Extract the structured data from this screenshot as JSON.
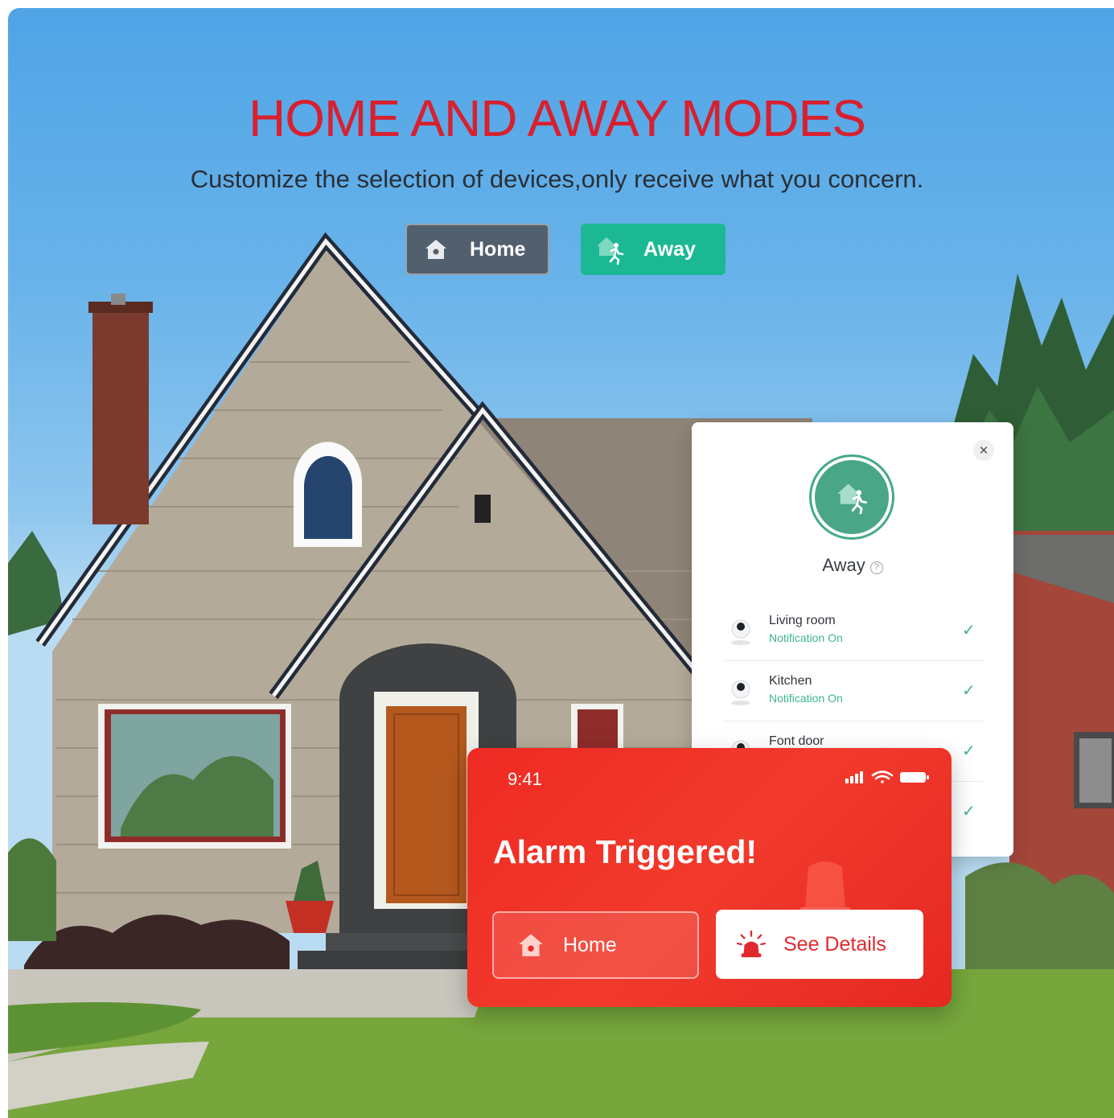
{
  "headline": "HOME AND AWAY MODES",
  "subline": "Customize the selection of devices,only receive what you concern.",
  "mode_buttons": {
    "home_label": "Home",
    "away_label": "Away"
  },
  "panel": {
    "mode_title": "Away",
    "help_glyph": "?",
    "close_glyph": "✕",
    "devices": [
      {
        "name": "Living room",
        "status": "Notification On"
      },
      {
        "name": "Kitchen",
        "status": "Notification On"
      },
      {
        "name": "Font door",
        "status": ""
      },
      {
        "name": "",
        "status": ""
      }
    ]
  },
  "alarm": {
    "time": "9:41",
    "title": "Alarm Triggered!",
    "home_label": "Home",
    "details_label": "See Details"
  },
  "colors": {
    "headline": "#d8202f",
    "away_accent": "#1cb894",
    "alarm_red": "#ee2a23"
  },
  "icons": [
    "home-icon",
    "away-runner-icon",
    "close-icon",
    "help-icon",
    "camera-icon",
    "check-icon",
    "signal-icon",
    "wifi-icon",
    "battery-icon",
    "siren-icon"
  ]
}
